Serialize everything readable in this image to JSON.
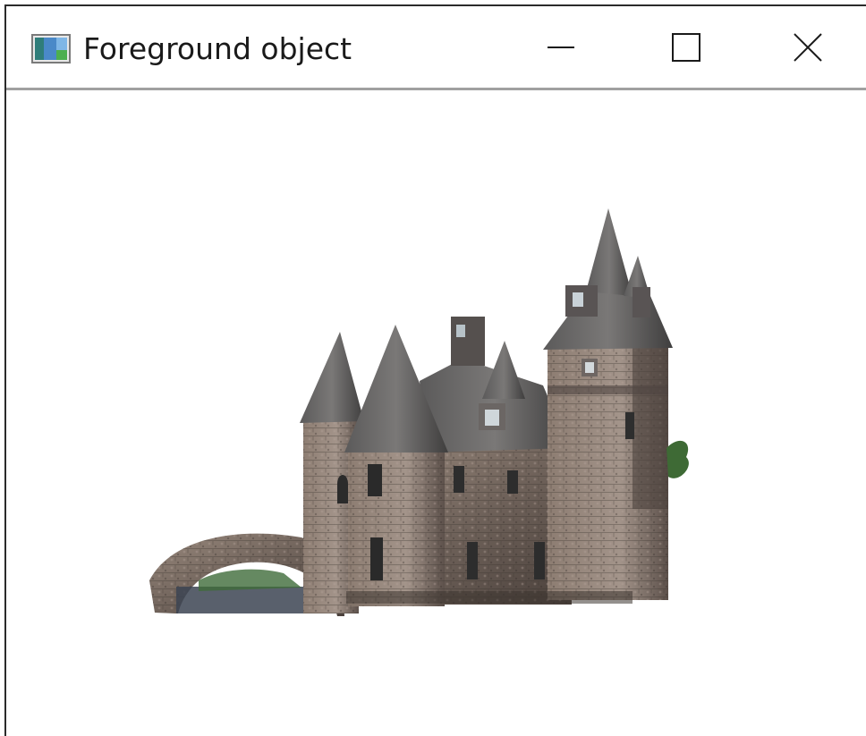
{
  "window": {
    "title": "Foreground object",
    "icon": "app-window-icon",
    "controls": {
      "minimize_icon": "minimize-icon",
      "maximize_icon": "maximize-icon",
      "close_icon": "close-icon"
    }
  },
  "content": {
    "image_subject": "castle-foreground-image",
    "background_color": "#ffffff"
  }
}
